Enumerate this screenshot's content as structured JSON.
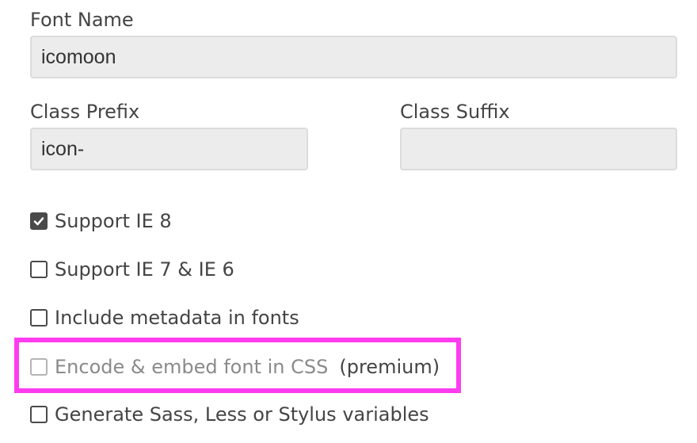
{
  "form": {
    "font_name": {
      "label": "Font Name",
      "value": "icomoon"
    },
    "class_prefix": {
      "label": "Class Prefix",
      "value": "icon-"
    },
    "class_suffix": {
      "label": "Class Suffix",
      "value": ""
    }
  },
  "options": [
    {
      "label": "Support IE 8",
      "checked": true,
      "disabled": false
    },
    {
      "label": "Support IE 7 & IE 6",
      "checked": false,
      "disabled": false
    },
    {
      "label": "Include metadata in fonts",
      "checked": false,
      "disabled": false
    },
    {
      "label": "Encode & embed font in CSS",
      "checked": false,
      "disabled": true,
      "badge": "(premium)"
    },
    {
      "label": "Generate Sass, Less or Stylus variables",
      "checked": false,
      "disabled": false
    }
  ],
  "colors": {
    "highlight": "#ff3cf0",
    "field_background": "#ececec",
    "checked_fill": "#4a4a4a"
  },
  "icons": {
    "checked": "check-icon"
  }
}
